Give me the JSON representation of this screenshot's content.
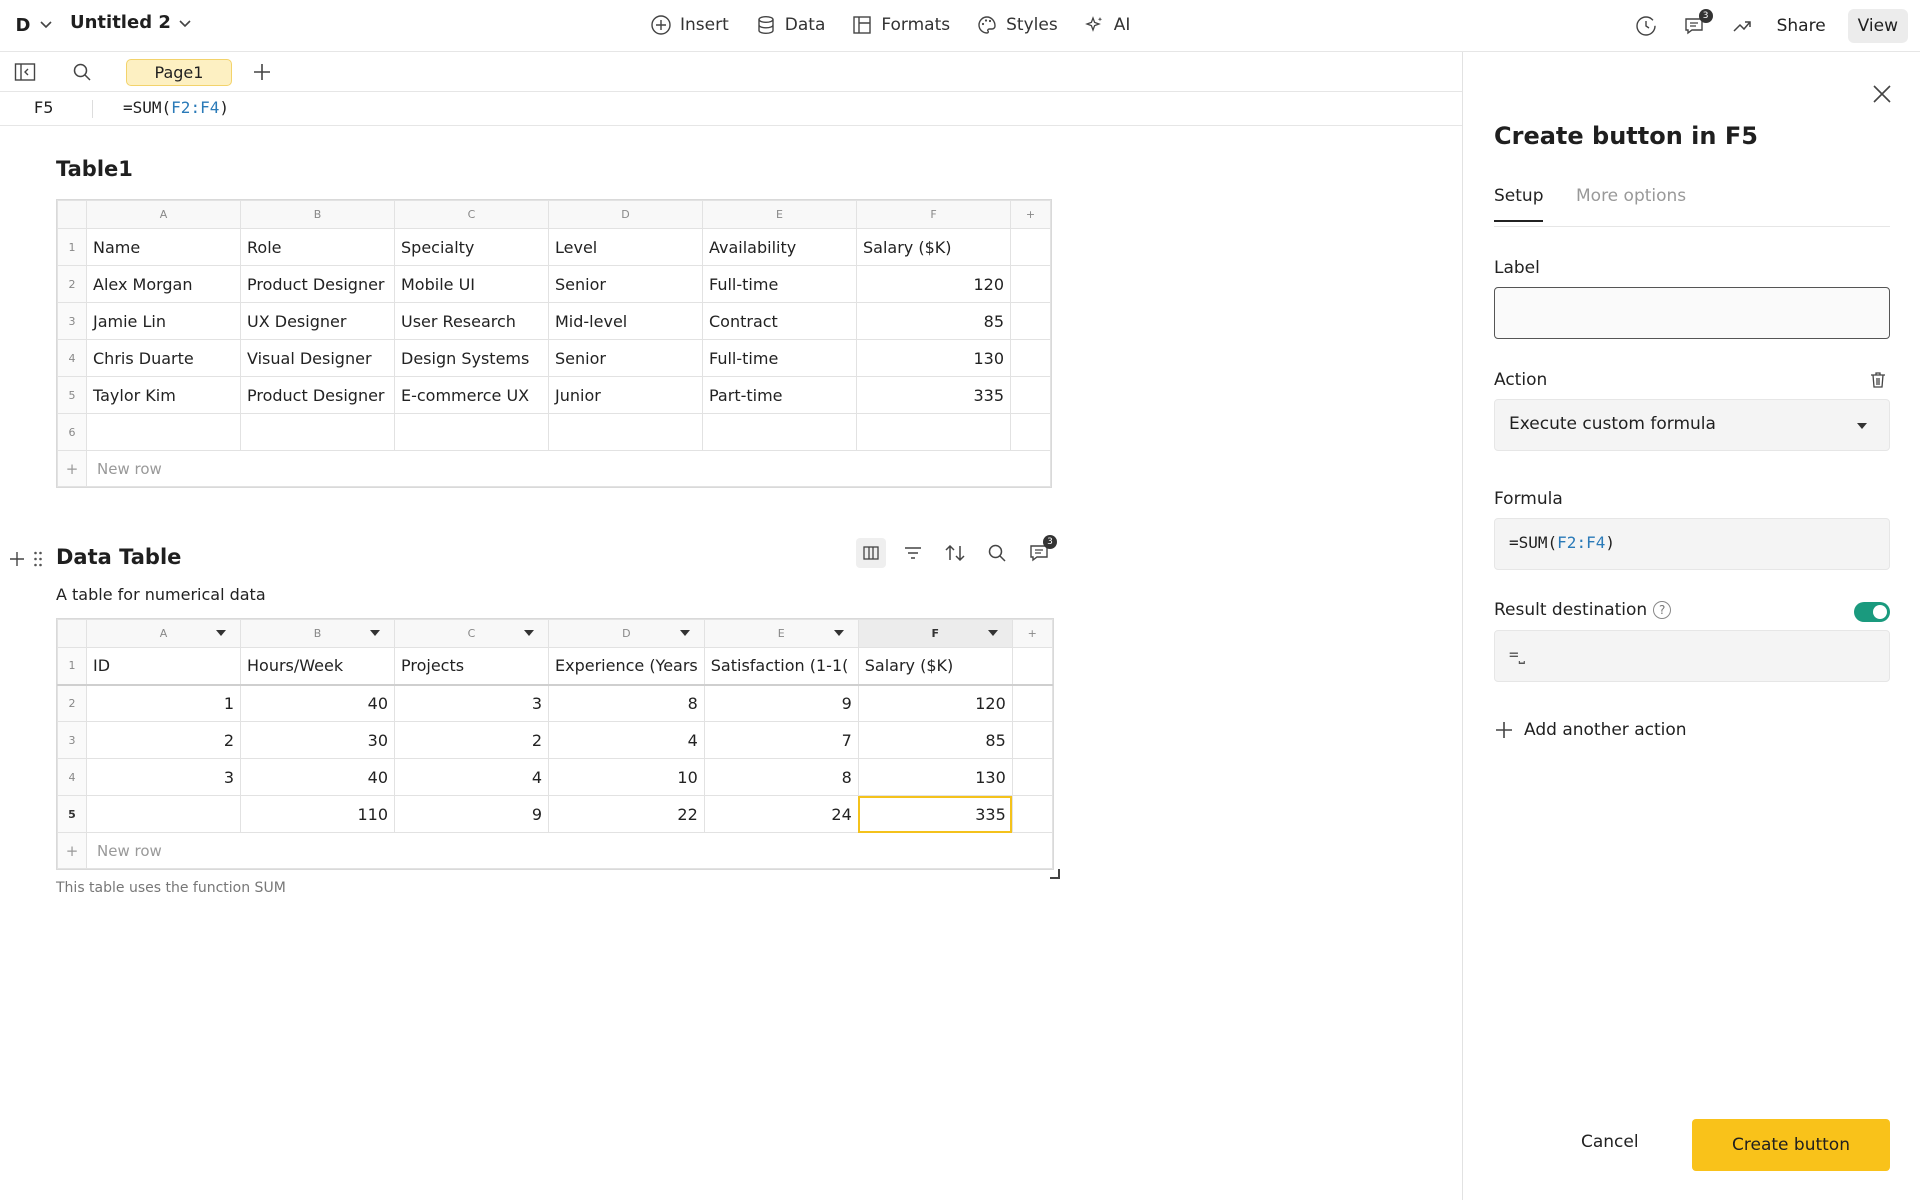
{
  "topbar": {
    "workspace_initial": "D",
    "doc_title": "Untitled 2",
    "nav": [
      {
        "label": "Insert",
        "icon": "plus-circle-icon"
      },
      {
        "label": "Data",
        "icon": "database-icon"
      },
      {
        "label": "Formats",
        "icon": "formats-icon"
      },
      {
        "label": "Styles",
        "icon": "palette-icon"
      },
      {
        "label": "AI",
        "icon": "sparkle-icon"
      }
    ],
    "comments_count": "3",
    "share_label": "Share",
    "view_label": "View"
  },
  "subbar": {
    "page_tab": "Page1"
  },
  "formula_bar": {
    "cell_ref": "F5",
    "prefix": "=SUM(",
    "range": "F2:F4",
    "suffix": ")"
  },
  "table1": {
    "title": "Table1",
    "col_letters": [
      "A",
      "B",
      "C",
      "D",
      "E",
      "F"
    ],
    "rows": [
      {
        "n": "1",
        "cells": [
          "Name",
          "Role",
          "Specialty",
          "Level",
          "Availability",
          "Salary ($K)"
        ]
      },
      {
        "n": "2",
        "cells": [
          "Alex Morgan",
          "Product Designer",
          "Mobile UI",
          "Senior",
          "Full-time",
          "120"
        ]
      },
      {
        "n": "3",
        "cells": [
          "Jamie Lin",
          "UX Designer",
          "User Research",
          "Mid-level",
          "Contract",
          "85"
        ]
      },
      {
        "n": "4",
        "cells": [
          "Chris Duarte",
          "Visual Designer",
          "Design Systems",
          "Senior",
          "Full-time",
          "130"
        ]
      },
      {
        "n": "5",
        "cells": [
          "Taylor Kim",
          "Product Designer",
          "E-commerce UX",
          "Junior",
          "Part-time",
          "335"
        ]
      },
      {
        "n": "6",
        "cells": [
          "",
          "",
          "",
          "",
          "",
          ""
        ]
      }
    ],
    "new_row": "New row"
  },
  "data_table": {
    "title": "Data Table",
    "subtitle": "A table for numerical data",
    "comments_count": "3",
    "col_letters": [
      "A",
      "B",
      "C",
      "D",
      "E",
      "F"
    ],
    "header_row": {
      "n": "1",
      "cells": [
        "ID",
        "Hours/Week",
        "Projects",
        "Experience (Years",
        "Satisfaction (1-1(",
        "Salary ($K)"
      ]
    },
    "rows": [
      {
        "n": "2",
        "cells": [
          "1",
          "40",
          "3",
          "8",
          "9",
          "120"
        ]
      },
      {
        "n": "3",
        "cells": [
          "2",
          "30",
          "2",
          "4",
          "7",
          "85"
        ]
      },
      {
        "n": "4",
        "cells": [
          "3",
          "40",
          "4",
          "10",
          "8",
          "130"
        ]
      },
      {
        "n": "5",
        "cells": [
          "",
          "110",
          "9",
          "22",
          "24",
          "335"
        ]
      }
    ],
    "new_row": "New row",
    "footnote": "This table uses the function SUM"
  },
  "panel": {
    "title": "Create button in F5",
    "tabs": [
      "Setup",
      "More options"
    ],
    "label_title": "Label",
    "label_value": "",
    "action_title": "Action",
    "action_value": "Execute custom formula",
    "formula_title": "Formula",
    "formula_prefix": "=SUM(",
    "formula_range": "F2:F4",
    "formula_suffix": ")",
    "result_title": "Result destination",
    "result_help": "?",
    "result_toggle": true,
    "result_value": "=⎵",
    "add_action": "Add another action",
    "cancel": "Cancel",
    "create": "Create button"
  },
  "colors": {
    "accent": "#f9c21a",
    "toggle": "#1a9a7e",
    "ref": "#2a7ab8",
    "page_tab": "#fdf0c2"
  }
}
